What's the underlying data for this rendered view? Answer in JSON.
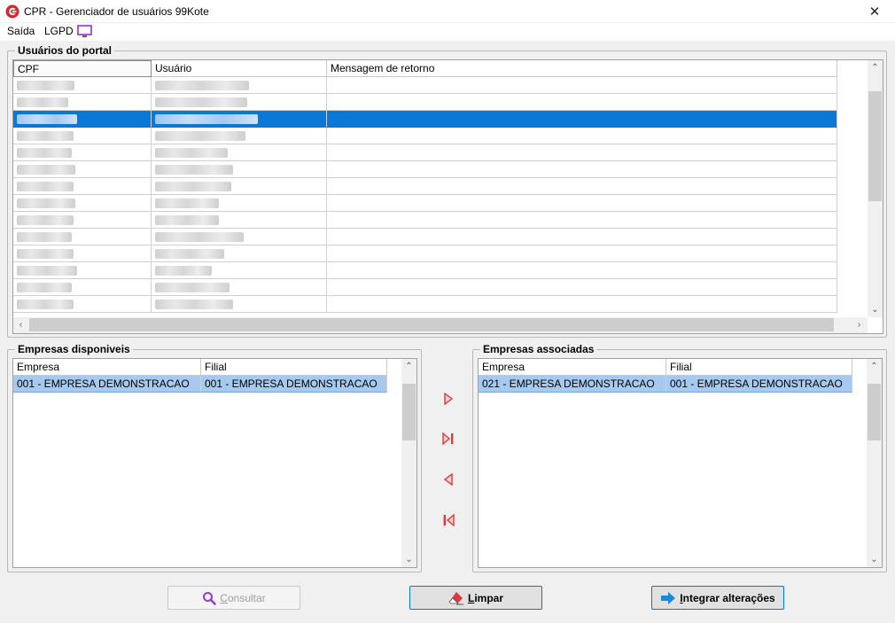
{
  "window": {
    "title": "CPR - Gerenciador de usuários 99Kote",
    "close_glyph": "✕",
    "logo_icon": "cpr-logo-icon",
    "accent": "#0a78d7"
  },
  "menu": {
    "items": [
      {
        "label": "Saída"
      },
      {
        "label": "LGPD"
      }
    ],
    "monitor_icon": "monitor-icon"
  },
  "users": {
    "legend": "Usuários do portal",
    "columns": [
      "CPF",
      "Usuário",
      "Mensagem de retorno"
    ],
    "row_count": 14,
    "selected_row": 2,
    "note": "CPF and Usuário cell contents are pixelated/obscured in the screenshot"
  },
  "available": {
    "legend": "Empresas disponiveis",
    "columns": [
      "Empresa",
      "Filial"
    ],
    "rows": [
      {
        "empresa": "001 - EMPRESA DEMONSTRACAO",
        "filial": "001 - EMPRESA DEMONSTRACAO"
      }
    ]
  },
  "associated": {
    "legend": "Empresas associadas",
    "columns": [
      "Empresa",
      "Filial"
    ],
    "rows": [
      {
        "empresa": "021 - EMPRESA DEMONSTRACAO",
        "filial": "001 - EMPRESA DEMONSTRACAO"
      }
    ]
  },
  "move_buttons": [
    {
      "name": "move-selected-right-icon"
    },
    {
      "name": "move-all-right-icon"
    },
    {
      "name": "move-selected-left-icon"
    },
    {
      "name": "move-all-left-icon"
    }
  ],
  "actions": {
    "consultar": {
      "letter": "C",
      "rest": "onsultar",
      "icon": "search-icon",
      "enabled": false
    },
    "limpar": {
      "letter": "L",
      "rest": "impar",
      "icon": "eraser-icon"
    },
    "integrar": {
      "letter": "I",
      "rest": "ntegrar alterações",
      "icon": "arrow-right-icon"
    }
  }
}
